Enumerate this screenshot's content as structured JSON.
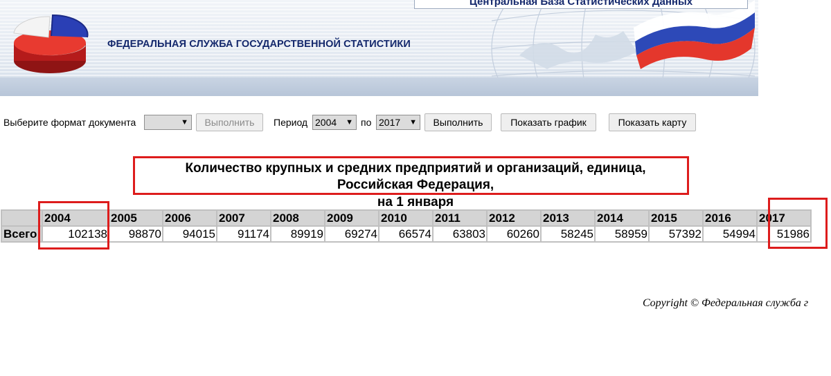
{
  "header": {
    "site_title": "Центральная База Статистических Данных",
    "agency_title": "ФЕДЕРАЛЬНАЯ СЛУЖБА ГОСУДАРСТВЕННОЙ СТАТИСТИКИ"
  },
  "toolbar": {
    "format_label": "Выберите формат документа",
    "format_value": "",
    "execute_disabled_label": "Выполнить",
    "period_label": "Период",
    "period_from": "2004",
    "to_label": "по",
    "period_to": "2017",
    "execute_label": "Выполнить",
    "show_chart_label": "Показать график",
    "show_map_label": "Показать карту",
    "dropdown_arrow": "▼"
  },
  "report": {
    "title_line1": "Количество крупных и средних предприятий и организаций, единица,",
    "title_line2": "Российская Федерация,",
    "title_line3": "на 1 января"
  },
  "table": {
    "row_label": "Всего",
    "years": [
      "2004",
      "2005",
      "2006",
      "2007",
      "2008",
      "2009",
      "2010",
      "2011",
      "2012",
      "2013",
      "2014",
      "2015",
      "2016",
      "2017"
    ],
    "values": [
      "102138",
      "98870",
      "94015",
      "91174",
      "89919",
      "69274",
      "66574",
      "63803",
      "60260",
      "58245",
      "58959",
      "57392",
      "54994",
      "51986"
    ]
  },
  "footer": {
    "copyright": "Copyright © Федеральная служба г"
  },
  "colors": {
    "highlight_red": "#dd1c1c",
    "banner_text": "#15296d"
  }
}
